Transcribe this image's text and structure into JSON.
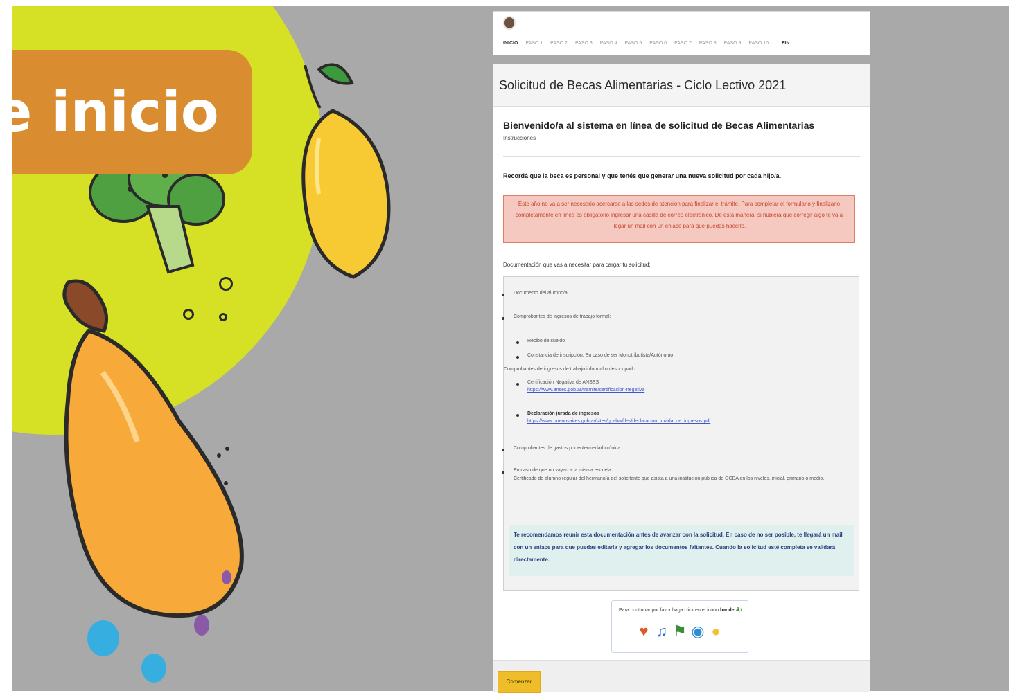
{
  "banner": {
    "title": "e inicio"
  },
  "stepbar": {
    "steps": [
      "INICIO",
      "PASO 1",
      "PASO 2",
      "PASO 3",
      "PASO 4",
      "PASO 5",
      "PASO 6",
      "PASO 7",
      "PASO 8",
      "PASO 9",
      "PASO 10"
    ],
    "end": "FIN"
  },
  "card": {
    "title": "Solicitud de Becas Alimentarias - Ciclo Lectivo 2021",
    "welcome": "Bienvenido/a al sistema en línea de solicitud de Becas Alimentarias",
    "instructions": "Instrucciones",
    "remember": "Recordá que la beca es personal y que tenés que generar una nueva solicitud por cada hijo/a.",
    "alert": "Este año no va a ser necesario acercarse a las sedes de atención para finalizar el trámite. Para completar el formulario y finalizarlo completamente en línea es obligatorio ingresar una casilla de correo electrónico. De esta manera, si hubiera que corregir algo te va a llegar un mail con un enlace para que puedas hacerlo.",
    "docs_heading": "Documentación que vas a necesitar para cargar tu solicitud:",
    "docs": {
      "d1": "Documento del alumno/a",
      "d2": "Comprobantes de ingresos de trabajo formal:",
      "d2a": "Recibo de sueldo",
      "d2b": "Constancia de inscripción. En caso de ser Monotributista/Autónomo",
      "d3": "Comprobantes de ingresos de trabajo informal o desocupado:",
      "d3a": "Certificación Negativa de ANSES",
      "d3a_link": "https://www.anses.gob.ar/tramite/certificacion-negativa",
      "d3b": "Declaración jurada de ingresos",
      "d3b_link": "https://www.buenosaires.gob.ar/sites/gcaba/files/declaracion_jurada_de_ingresos.pdf",
      "d4": "Comprobantes de gastos por enfermedad crónica.",
      "d5": "En caso de que no vayan a la misma escuela:",
      "d5b": "Certificado de alumno regular del hermano/a del solicitante que asista a una institución pública de GCBA en los niveles, inicial, primario o medio."
    },
    "note": "Te recomendamos reunir esta documentación antes de avanzar con la solicitud. En caso de no ser posible, te llegará un mail con un enlace para que puedas editarla y agregar los documentos faltantes. Cuando la solicitud esté completa se validará directamente.",
    "captcha": {
      "prefix": "Para continuar por favor haga click en el icono",
      "target": "bandera",
      "icons": [
        "heart-icon",
        "music-note-icon",
        "flag-icon",
        "clock-icon",
        "lightbulb-icon"
      ]
    },
    "start_label": "Comenzar"
  },
  "colors": {
    "lime": "#d6e125",
    "orange_pill": "#d98c30",
    "alert_bg": "#f6c9c0",
    "note_bg": "#dff0ee",
    "button": "#f0bd2a"
  }
}
